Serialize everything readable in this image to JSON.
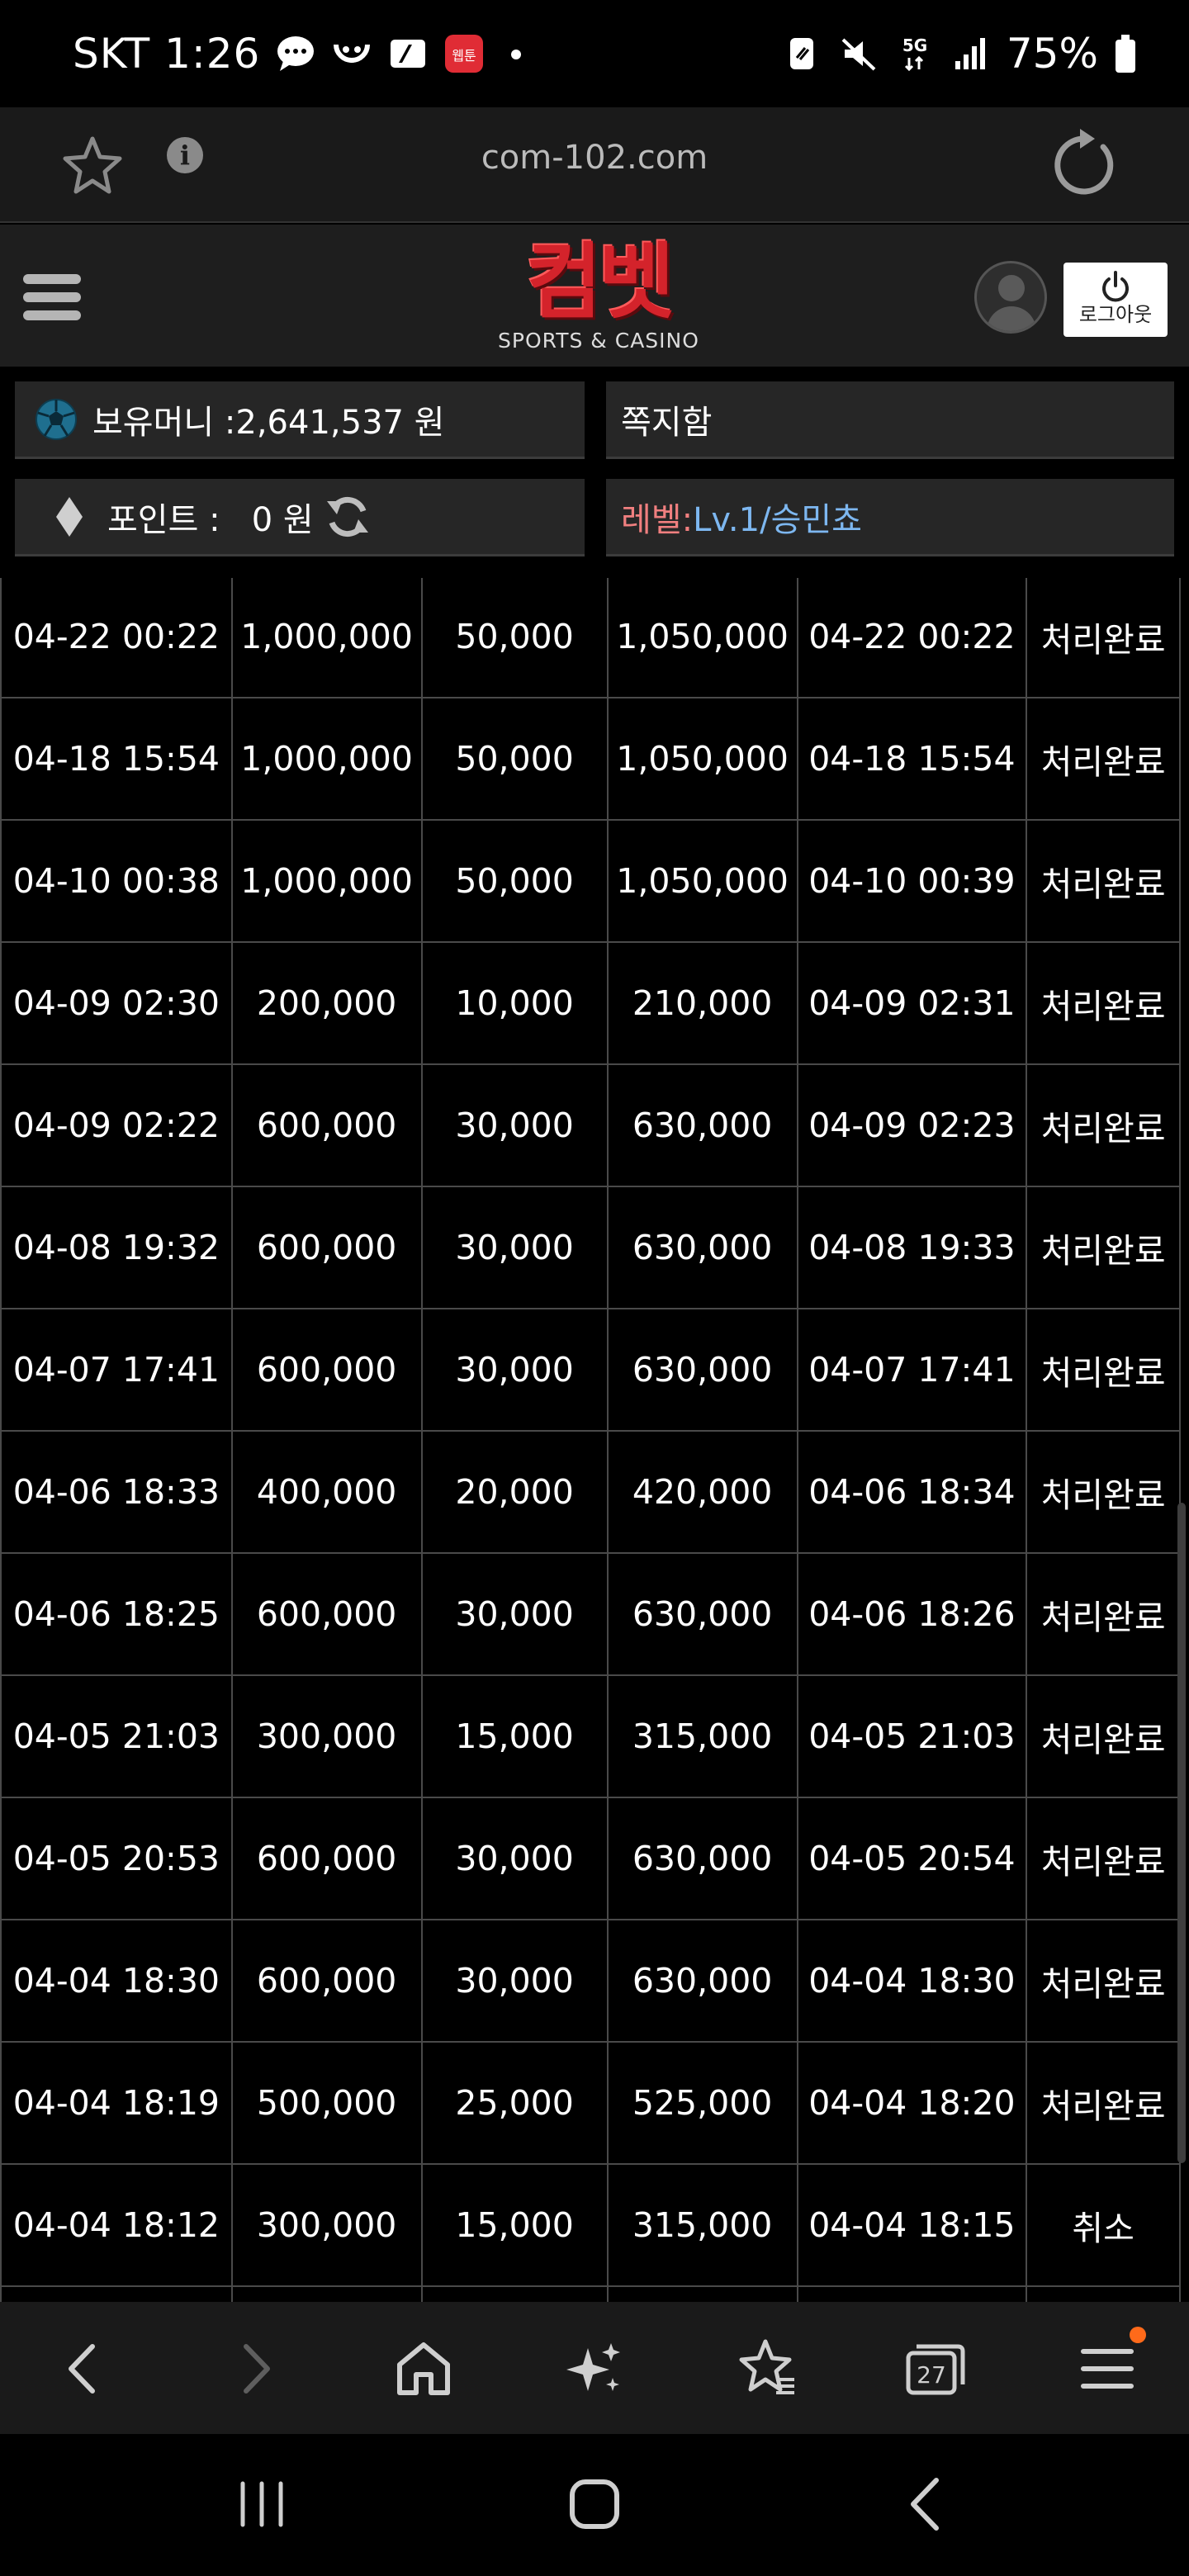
{
  "status_bar": {
    "carrier_time": "SKT 1:26",
    "network": "5G",
    "battery": "75%",
    "app_badge": "웹툰"
  },
  "url_bar": {
    "url": "com-102.com"
  },
  "header": {
    "logo_main": "컴벳",
    "logo_sub": "SPORTS & CASINO",
    "logout_label": "로그아웃"
  },
  "account": {
    "money_text": "보유머니 :2,641,537 원",
    "messages_text": "쪽지함",
    "point_text": "포인트 :   0 원",
    "level_label": "레벨:",
    "level_value": "Lv.1/승민쵸"
  },
  "table": {
    "rows": [
      [
        "04-22 00:22",
        "1,000,000",
        "50,000",
        "1,050,000",
        "04-22 00:22",
        "처리완료"
      ],
      [
        "04-18 15:54",
        "1,000,000",
        "50,000",
        "1,050,000",
        "04-18 15:54",
        "처리완료"
      ],
      [
        "04-10 00:38",
        "1,000,000",
        "50,000",
        "1,050,000",
        "04-10 00:39",
        "처리완료"
      ],
      [
        "04-09 02:30",
        "200,000",
        "10,000",
        "210,000",
        "04-09 02:31",
        "처리완료"
      ],
      [
        "04-09 02:22",
        "600,000",
        "30,000",
        "630,000",
        "04-09 02:23",
        "처리완료"
      ],
      [
        "04-08 19:32",
        "600,000",
        "30,000",
        "630,000",
        "04-08 19:33",
        "처리완료"
      ],
      [
        "04-07 17:41",
        "600,000",
        "30,000",
        "630,000",
        "04-07 17:41",
        "처리완료"
      ],
      [
        "04-06 18:33",
        "400,000",
        "20,000",
        "420,000",
        "04-06 18:34",
        "처리완료"
      ],
      [
        "04-06 18:25",
        "600,000",
        "30,000",
        "630,000",
        "04-06 18:26",
        "처리완료"
      ],
      [
        "04-05 21:03",
        "300,000",
        "15,000",
        "315,000",
        "04-05 21:03",
        "처리완료"
      ],
      [
        "04-05 20:53",
        "600,000",
        "30,000",
        "630,000",
        "04-05 20:54",
        "처리완료"
      ],
      [
        "04-04 18:30",
        "600,000",
        "30,000",
        "630,000",
        "04-04 18:30",
        "처리완료"
      ],
      [
        "04-04 18:19",
        "500,000",
        "25,000",
        "525,000",
        "04-04 18:20",
        "처리완료"
      ],
      [
        "04-04 18:12",
        "300,000",
        "15,000",
        "315,000",
        "04-04 18:15",
        "취소"
      ],
      [
        "",
        "",
        "",
        "",
        "",
        ""
      ]
    ]
  },
  "bottom_nav": {
    "tabs_count": "27"
  },
  "colors": {
    "background": "#000000",
    "panel": "#262626",
    "header": "#1e1e1e",
    "logo_red": "#d4232b",
    "level_label": "#f07f7f",
    "level_value": "#7db7f0",
    "notification_dot": "#ff6a1a"
  },
  "icons": [
    "chat-icon",
    "smile-icon",
    "card-icon",
    "webtoon-icon",
    "nfc-icon",
    "mute-icon",
    "signal-icon",
    "battery-icon",
    "star-icon",
    "info-icon",
    "reload-icon",
    "hamburger-icon",
    "user-icon",
    "power-icon",
    "soccer-ball-icon",
    "diamond-icon",
    "refresh-icon",
    "back-icon",
    "forward-icon",
    "home-icon",
    "sparkle-icon",
    "bookmark-icon",
    "tabs-icon",
    "menu-icon"
  ]
}
